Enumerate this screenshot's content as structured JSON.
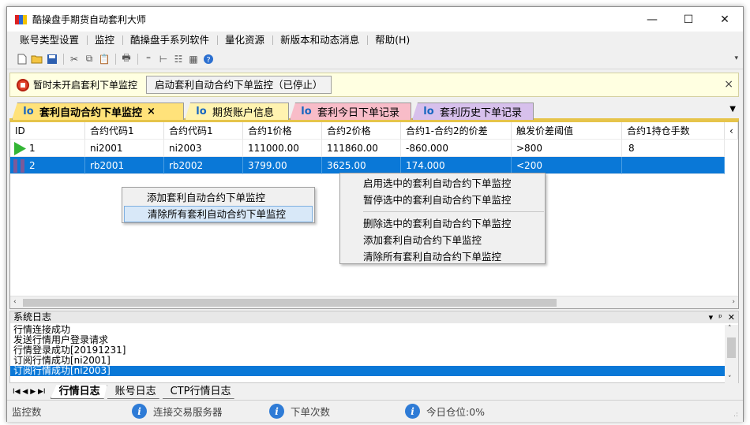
{
  "window": {
    "title": "酷操盘手期货自动套利大师",
    "minimize_icon": "—",
    "maximize_icon": "☐",
    "close_icon": "✕"
  },
  "menu": [
    "账号类型设置",
    "监控",
    "酷操盘手系列软件",
    "量化资源",
    "新版本和动态消息",
    "帮助(H)"
  ],
  "toolbar_icons": [
    "new-file",
    "open-folder",
    "save",
    "cut",
    "copy",
    "paste",
    "print",
    "align",
    "tree",
    "list",
    "table",
    "help"
  ],
  "notice": {
    "status_text": "暂时未开启套利下单监控",
    "button_label": "启动套利自动合约下单监控（已停止）",
    "close": "×"
  },
  "tabs": [
    {
      "label": "套利自动合约下单监控",
      "close": "×",
      "color": "#ffe27a",
      "active": true
    },
    {
      "label": "期货账户信息",
      "color": "#fff3b0"
    },
    {
      "label": "套利今日下单记录",
      "color": "#f8bcc8"
    },
    {
      "label": "套利历史下单记录",
      "color": "#d7c0ec"
    }
  ],
  "tab_icon_glyph": "lo",
  "grid": {
    "columns": [
      "ID",
      "合约代码1",
      "合约代码1",
      "合约1价格",
      "合约2价格",
      "合约1-合约2的价差",
      "触发价差阈值",
      "合约1持仓手数"
    ],
    "rows": [
      {
        "id": "1",
        "c1": "ni2001",
        "c2": "ni2003",
        "p1": "111000.00",
        "p2": "111860.00",
        "diff": "-860.000",
        "trigger": ">800",
        "qty": "8",
        "status": "running"
      },
      {
        "id": "2",
        "c1": "rb2001",
        "c2": "rb2002",
        "p1": "3799.00",
        "p2": "3625.00",
        "diff": "174.000",
        "trigger": "<200",
        "qty": "",
        "status": "paused"
      }
    ]
  },
  "context_menu_small": [
    "添加套利自动合约下单监控",
    "清除所有套利自动合约下单监控"
  ],
  "context_menu_large": {
    "group1": [
      "启用选中的套利自动合约下单监控",
      "暂停选中的套利自动合约下单监控"
    ],
    "group2": [
      "删除选中的套利自动合约下单监控",
      "添加套利自动合约下单监控",
      "清除所有套利自动合约下单监控"
    ]
  },
  "log": {
    "title": "系统日志",
    "lines": [
      "行情连接成功",
      "发送行情用户登录请求",
      "行情登录成功[20191231]",
      "订阅行情成功[ni2001]",
      "订阅行情成功[ni2003]"
    ],
    "tabs": [
      "行情日志",
      "账号日志",
      "CTP行情日志"
    ]
  },
  "status": [
    "监控数",
    "连接交易服务器",
    "下单次数",
    "今日仓位:0%"
  ]
}
